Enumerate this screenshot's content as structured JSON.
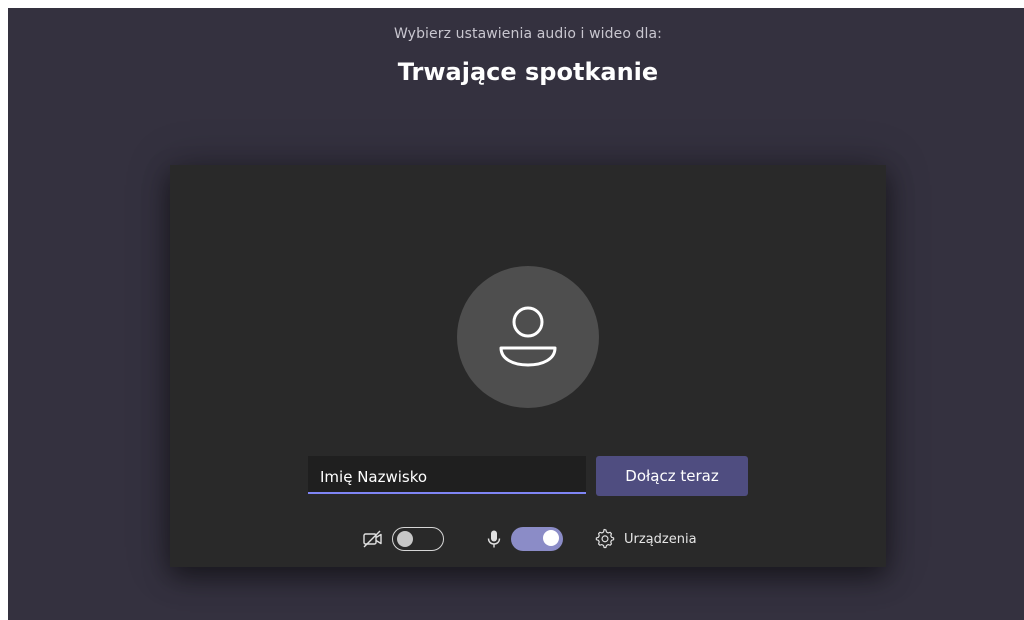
{
  "header": {
    "subtitle": "Wybierz ustawienia audio i wideo dla:",
    "title": "Trwające spotkanie"
  },
  "prejoin": {
    "name_input": {
      "value": "Imię Nazwisko",
      "placeholder": ""
    },
    "join_button_label": "Dołącz teraz",
    "camera": {
      "icon": "camera-off-icon",
      "enabled": false
    },
    "microphone": {
      "icon": "microphone-icon",
      "enabled": true
    },
    "devices": {
      "icon": "gear-icon",
      "label": "Urządzenia"
    }
  },
  "colors": {
    "background": "#34313f",
    "panel": "#292929",
    "avatar": "#4e4e4e",
    "join_button": "#4f4d80",
    "toggle_on": "#8b8cc7",
    "input_underline": "#7f85f5"
  }
}
